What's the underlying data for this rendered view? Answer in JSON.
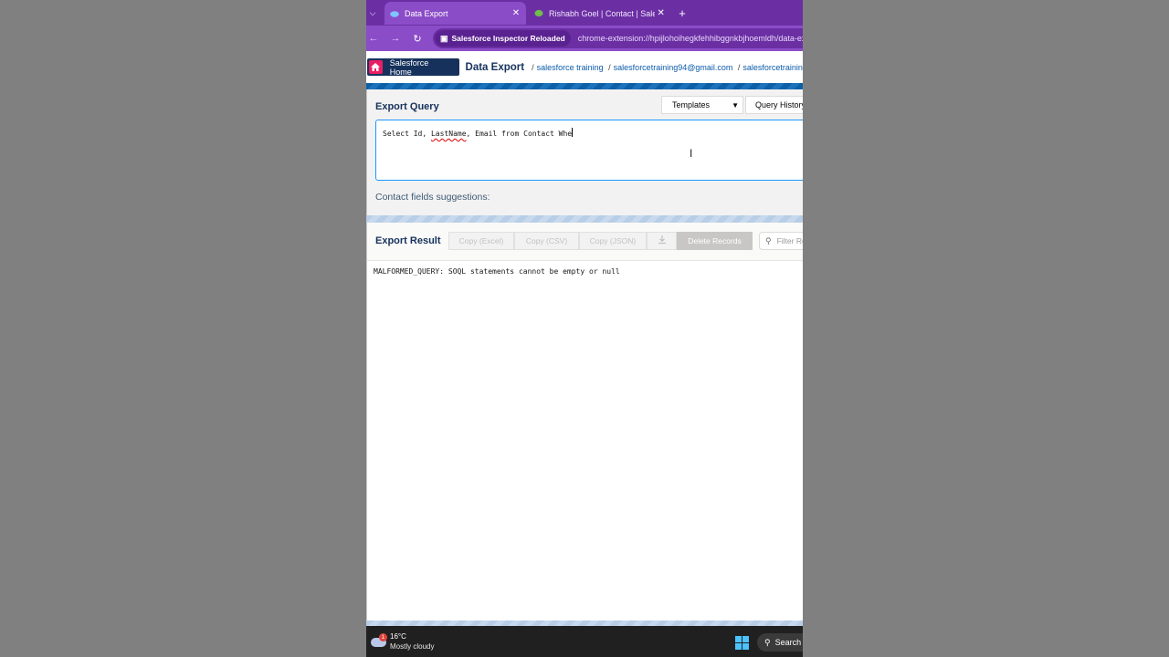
{
  "browser": {
    "tabs": [
      {
        "title": "Data Export",
        "active": true
      },
      {
        "title": "Rishabh Goel | Contact | Salesfo",
        "active": false
      }
    ],
    "new_tab": "+",
    "close_glyph": "✕",
    "extension_chip": "Salesforce Inspector Reloaded",
    "url": "chrome-extension://hpijlohoihegkfehhibggnkbjhoemldh/data-export"
  },
  "header": {
    "home_button": "Salesforce Home",
    "page_title": "Data Export",
    "breadcrumbs": [
      "salesforce training",
      "salesforcetraining94@gmail.com",
      "salesforcetraining"
    ]
  },
  "query": {
    "title": "Export Query",
    "templates_label": "Templates",
    "history_label": "Query History",
    "text_parts": [
      "Select Id, ",
      "LastName",
      ", Email from Contact Whe"
    ],
    "suggestions": "Contact fields suggestions:"
  },
  "result": {
    "title": "Export Result",
    "buttons": {
      "copy_excel": "Copy (Excel)",
      "copy_csv": "Copy (CSV)",
      "copy_json": "Copy (JSON)",
      "delete": "Delete Records"
    },
    "filter_placeholder": "Filter Results",
    "message": "MALFORMED_QUERY: SOQL statements cannot be empty or null"
  },
  "taskbar": {
    "temperature": "16°C",
    "weather": "Mostly cloudy",
    "weather_badge": "1",
    "search": "Search"
  },
  "colors": {
    "browser_frame": "#6b2fa3",
    "salesforce_navy": "#16325c",
    "link_blue": "#0b5cab",
    "editor_focus": "#1b96ff"
  }
}
